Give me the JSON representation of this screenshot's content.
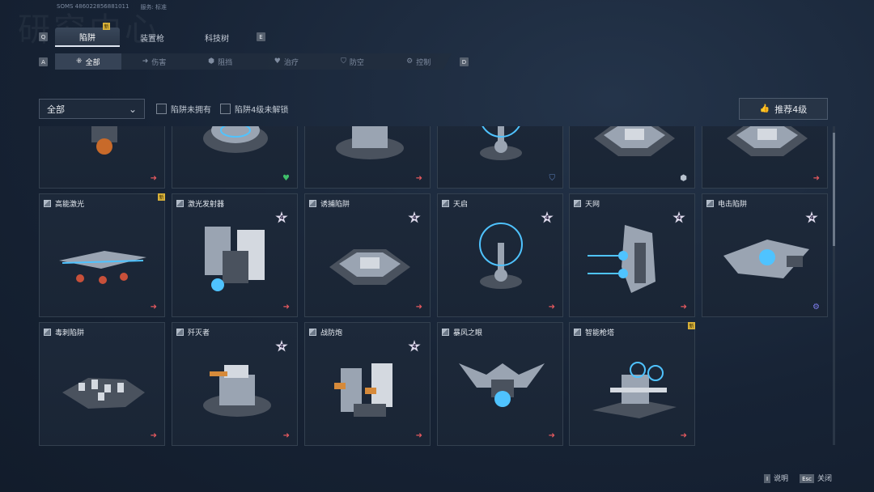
{
  "header": {
    "watermark": "研究中心",
    "user_id": "SOMS 486022856881011",
    "server_label": "服务: 标准"
  },
  "keys": {
    "tab_prev": "Q",
    "tab_next": "E",
    "filter_prev": "A",
    "filter_next": "D"
  },
  "tabs": [
    {
      "label": "陷阱",
      "active": true,
      "new": true
    },
    {
      "label": "装置枪",
      "active": false,
      "new": false
    },
    {
      "label": "科技树",
      "active": false,
      "new": false
    }
  ],
  "filters": [
    {
      "label": "全部",
      "icon": "grid-icon",
      "glyph": "⁜",
      "active": true
    },
    {
      "label": "伤害",
      "icon": "arrow-icon",
      "glyph": "➜",
      "active": false
    },
    {
      "label": "阻挡",
      "icon": "block-icon",
      "glyph": "⬢",
      "active": false
    },
    {
      "label": "治疗",
      "icon": "heart-icon",
      "glyph": "♥",
      "active": false
    },
    {
      "label": "防空",
      "icon": "shield-icon",
      "glyph": "⛉",
      "active": false
    },
    {
      "label": "控制",
      "icon": "gear-icon",
      "glyph": "⚙",
      "active": false
    }
  ],
  "dropdown": {
    "value": "全部",
    "chevron": "⌄"
  },
  "checkboxes": [
    {
      "label": "陷阱未拥有",
      "checked": false
    },
    {
      "label": "陷阱4级未解锁",
      "checked": false
    }
  ],
  "recommend": {
    "label": "推荐4级",
    "icon": "thumb-up-icon",
    "glyph": "👍"
  },
  "cards": [
    {
      "name": "",
      "level": "",
      "new": false,
      "category": "damage",
      "cat_glyph": "➜",
      "art": "drill"
    },
    {
      "name": "",
      "level": "",
      "new": false,
      "category": "heal",
      "cat_glyph": "♥",
      "art": "pod"
    },
    {
      "name": "",
      "level": "",
      "new": false,
      "category": "damage",
      "cat_glyph": "➜",
      "art": "turret"
    },
    {
      "name": "",
      "level": "",
      "new": false,
      "category": "shield",
      "cat_glyph": "⛉",
      "art": "tower"
    },
    {
      "name": "",
      "level": "",
      "new": false,
      "category": "block",
      "cat_glyph": "⬢",
      "art": "plate"
    },
    {
      "name": "",
      "level": "",
      "new": false,
      "category": "damage",
      "cat_glyph": "➜",
      "art": "plate"
    },
    {
      "name": "高能激光",
      "level": "",
      "new": true,
      "category": "damage",
      "cat_glyph": "➜",
      "art": "laser"
    },
    {
      "name": "激光发射器",
      "level": "4",
      "new": false,
      "category": "damage",
      "cat_glyph": "➜",
      "art": "emitter"
    },
    {
      "name": "诱捕陷阱",
      "level": "4",
      "new": false,
      "category": "damage",
      "cat_glyph": "➜",
      "art": "plate"
    },
    {
      "name": "天启",
      "level": "4",
      "new": false,
      "category": "damage",
      "cat_glyph": "➜",
      "art": "tower"
    },
    {
      "name": "天网",
      "level": "4",
      "new": false,
      "category": "damage",
      "cat_glyph": "➜",
      "art": "net"
    },
    {
      "name": "电击陷阱",
      "level": "4",
      "new": false,
      "category": "ctrl",
      "cat_glyph": "⚙",
      "art": "shock"
    },
    {
      "name": "毒刺陷阱",
      "level": "",
      "new": false,
      "category": "damage",
      "cat_glyph": "➜",
      "art": "spike"
    },
    {
      "name": "歼灭者",
      "level": "4",
      "new": false,
      "category": "damage",
      "cat_glyph": "➜",
      "art": "turret"
    },
    {
      "name": "战防炮",
      "level": "4",
      "new": false,
      "category": "damage",
      "cat_glyph": "➜",
      "art": "cannon"
    },
    {
      "name": "暴风之眼",
      "level": "",
      "new": false,
      "category": "damage",
      "cat_glyph": "➜",
      "art": "eye"
    },
    {
      "name": "智能枪塔",
      "level": "",
      "new": true,
      "category": "damage",
      "cat_glyph": "➜",
      "art": "gun"
    }
  ],
  "new_badge": "新",
  "footer": [
    {
      "key": "I",
      "label": "说明"
    },
    {
      "key": "Esc",
      "label": "关闭"
    }
  ],
  "colors": {
    "accent": "#d9b23a",
    "damage": "#e2585e",
    "heal": "#3fbf6a",
    "glow": "#4fc3ff"
  }
}
